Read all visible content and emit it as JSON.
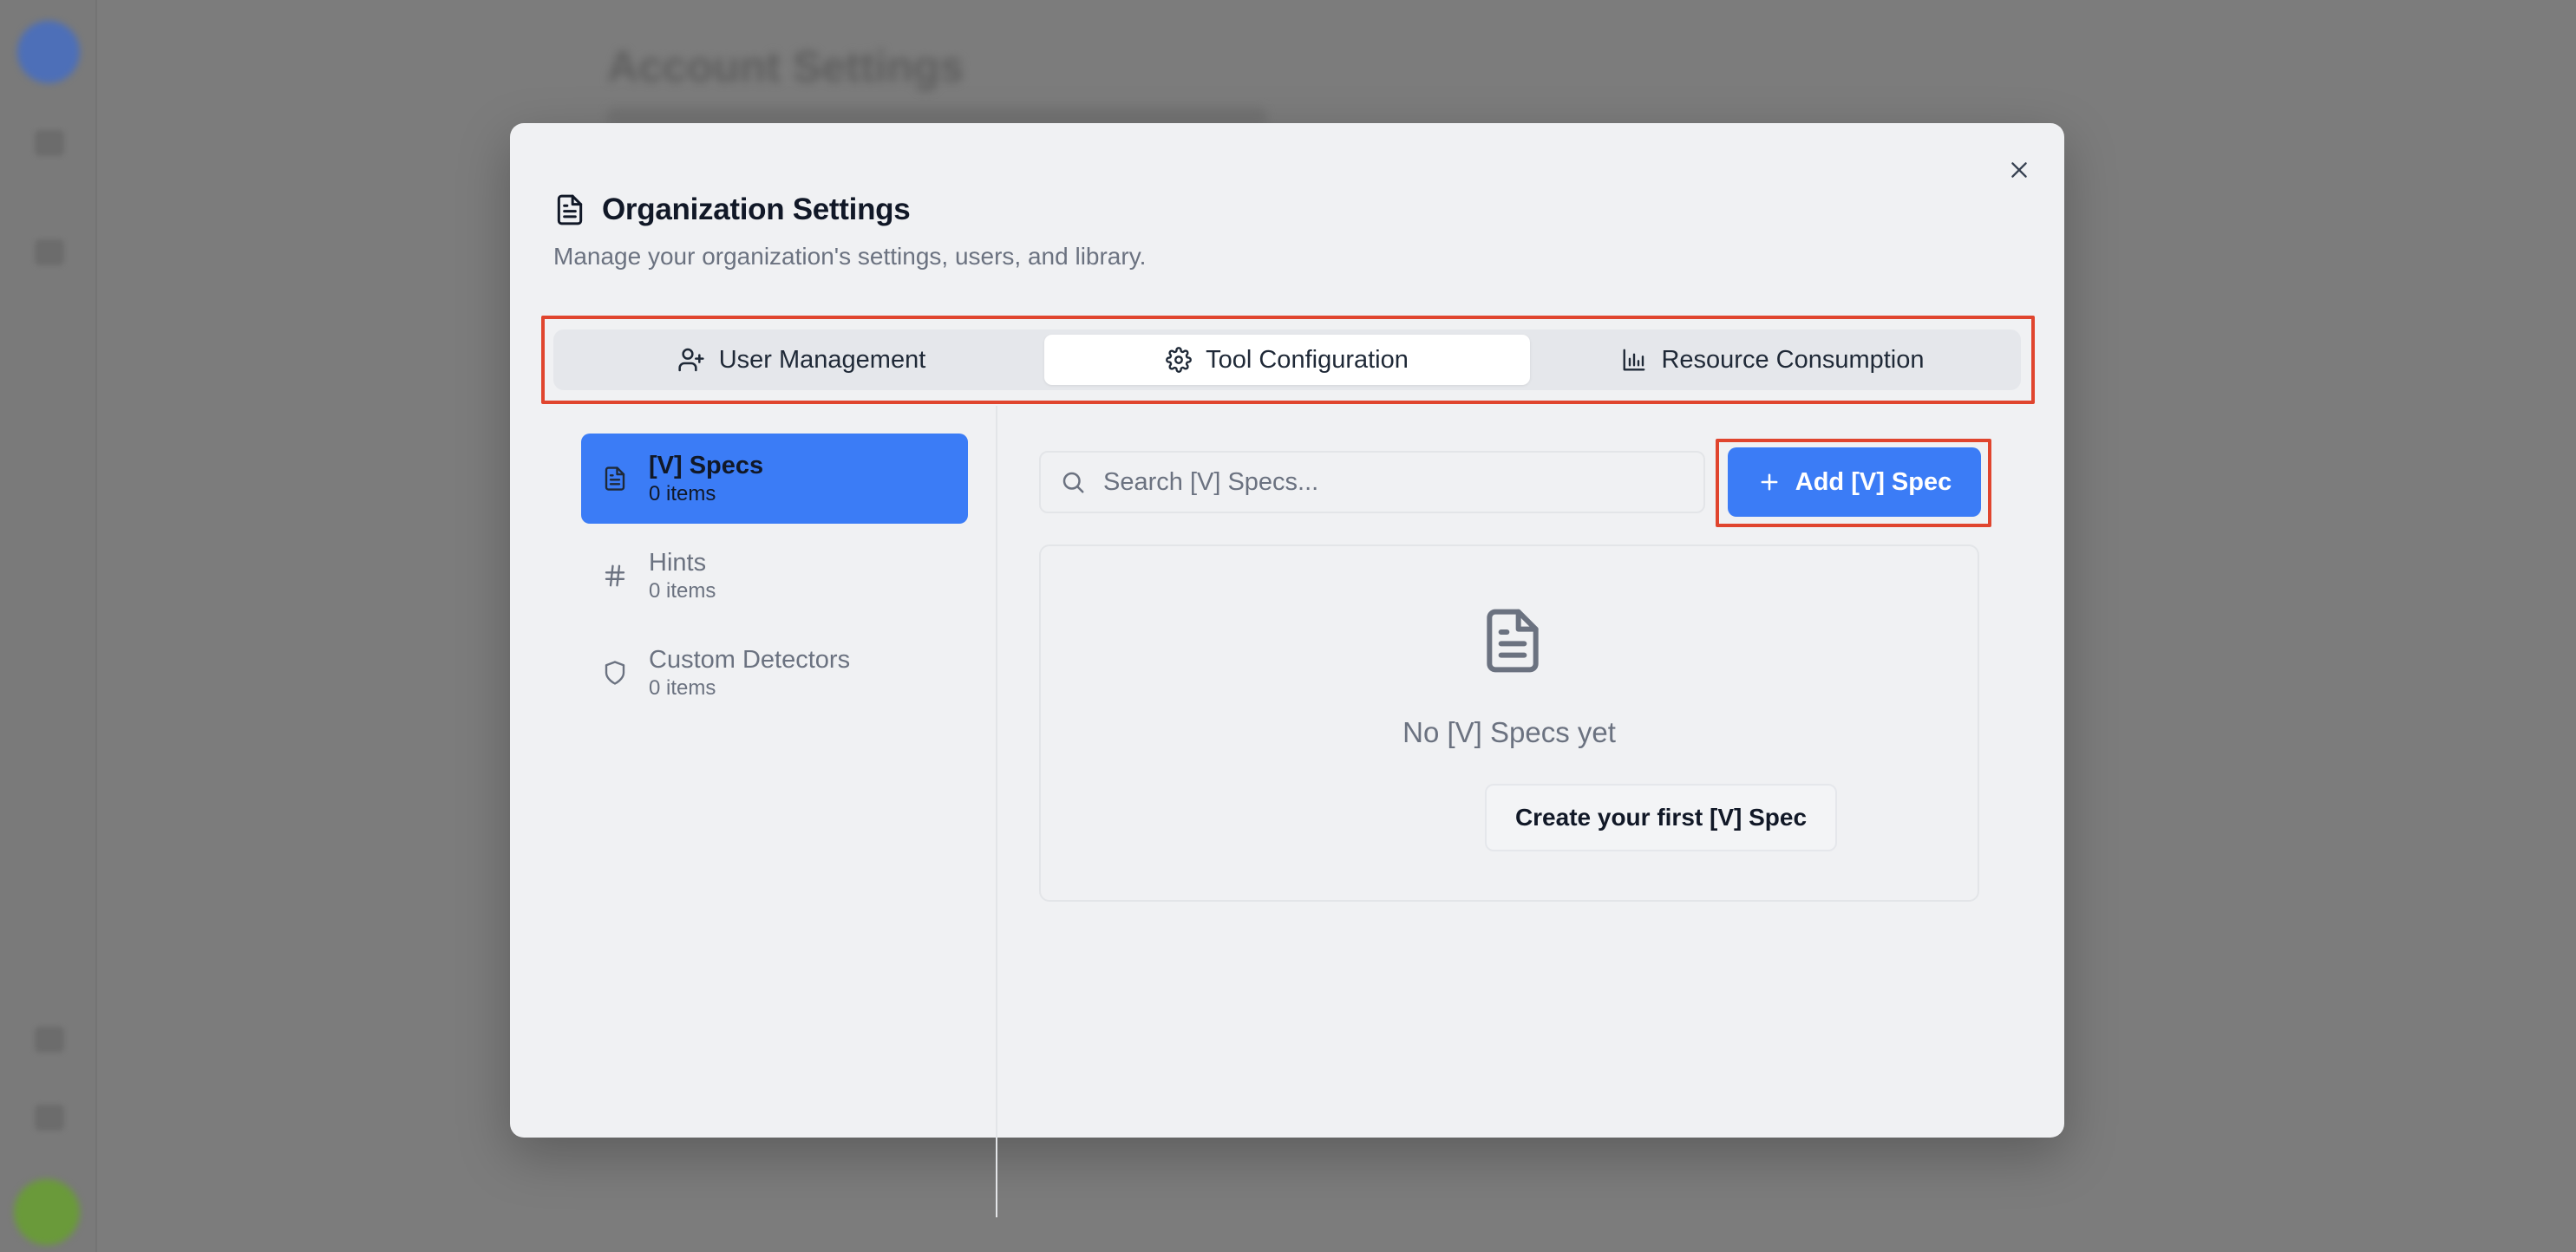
{
  "background": {
    "heading": "Account Settings"
  },
  "modal": {
    "title": "Organization Settings",
    "subtitle": "Manage your organization's settings, users, and library.",
    "title_icon": "document-icon",
    "close_icon": "close-icon"
  },
  "tabs": [
    {
      "label": "User Management",
      "icon": "user-plus-icon",
      "active": false
    },
    {
      "label": "Tool Configuration",
      "icon": "gear-icon",
      "active": true
    },
    {
      "label": "Resource Consumption",
      "icon": "bar-chart-icon",
      "active": false
    }
  ],
  "nav": [
    {
      "label": "[V] Specs",
      "count": "0 items",
      "icon": "document-icon",
      "active": true
    },
    {
      "label": "Hints",
      "count": "0 items",
      "icon": "hash-icon",
      "active": false
    },
    {
      "label": "Custom Detectors",
      "count": "0 items",
      "icon": "shield-icon",
      "active": false
    }
  ],
  "main": {
    "search_placeholder": "Search [V] Specs...",
    "add_label": "Add [V] Spec",
    "empty_text": "No [V] Specs yet",
    "create_label": "Create your first [V] Spec"
  },
  "colors": {
    "accent": "#3b7cf6",
    "highlight_outline": "#e0452e",
    "overlay": "#7f7f7f"
  }
}
